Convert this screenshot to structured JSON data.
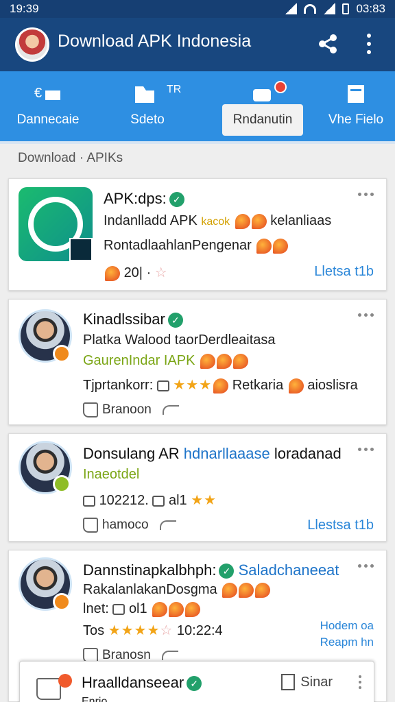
{
  "status": {
    "time": "19:39",
    "clock": "03:83"
  },
  "appbar": {
    "title": "Download APK Indonesia"
  },
  "tabs": [
    {
      "label": "Dannecaie"
    },
    {
      "label": "Sdeto",
      "badge_text": "TR"
    },
    {
      "label": "Rndanutin"
    },
    {
      "label": "Vhe Fielo"
    }
  ],
  "breadcrumb": "Download · APIKs",
  "cards": [
    {
      "title": "APK:dps:",
      "line1": "Indanlladd APK",
      "line1_tail": "kelanliaas",
      "line1_mid": "kacok",
      "line2": "RontadlaahlanPengenar",
      "meta": "20|",
      "link": "Lletsa t1b"
    },
    {
      "title": "Kinadlssibar",
      "line1": "Platka Walood taorDerdleaitasa",
      "line2": "GaurenIndar IAPK",
      "meta_left": "Tjprtankorr:",
      "meta_right": "Retkaria",
      "meta_tail": "aioslisra",
      "action": "Branoon"
    },
    {
      "title": "Donsulang AR",
      "title_blue": "hdnarllaaase",
      "title_tail": "loradanad",
      "line1": "Inaeotdel",
      "meta": "102212.",
      "meta2": "al1",
      "action": "hamoco",
      "link": "Llestsa t1b"
    },
    {
      "title": "Dannstinapkalbhph:",
      "title_blue": "Saladchaneeat",
      "line1": "RakalanlakanDosgma",
      "line2": "lnet:",
      "line2_b": "ol1",
      "meta": "Tos",
      "meta_time": "10:22:4",
      "link1": "Hodem oa",
      "link2": "Reapm hn",
      "action": "Branosn"
    }
  ],
  "sheet": {
    "title": "Hraalldanseear",
    "action": "Sinar",
    "sub": "Enrio"
  }
}
